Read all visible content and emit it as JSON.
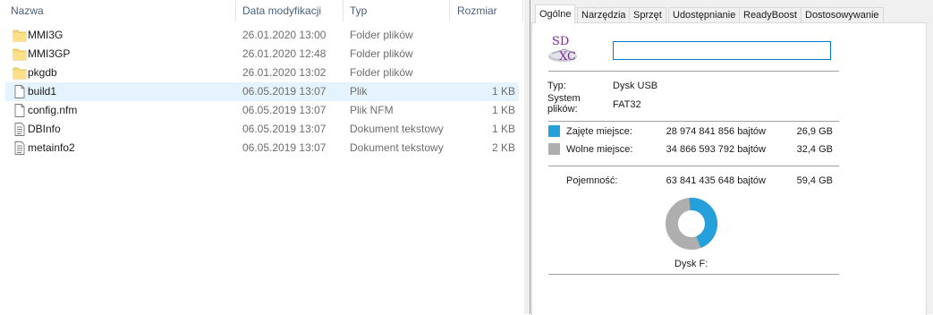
{
  "explorer": {
    "columns": {
      "name": "Nazwa",
      "date": "Data modyfikacji",
      "type": "Typ",
      "size": "Rozmiar"
    },
    "files": [
      {
        "name": "MMI3G",
        "date": "26.01.2020 13:00",
        "type": "Folder plików",
        "size": "",
        "icon": "folder-icon",
        "selected": false
      },
      {
        "name": "MMI3GP",
        "date": "26.01.2020 12:48",
        "type": "Folder plików",
        "size": "",
        "icon": "folder-icon",
        "selected": false
      },
      {
        "name": "pkgdb",
        "date": "26.01.2020 13:02",
        "type": "Folder plików",
        "size": "",
        "icon": "folder-icon",
        "selected": false
      },
      {
        "name": "build1",
        "date": "06.05.2019 13:07",
        "type": "Plik",
        "size": "1 KB",
        "icon": "file-icon",
        "selected": true
      },
      {
        "name": "config.nfm",
        "date": "06.05.2019 13:07",
        "type": "Plik NFM",
        "size": "1 KB",
        "icon": "file-icon",
        "selected": false
      },
      {
        "name": "DBInfo",
        "date": "06.05.2019 13:07",
        "type": "Dokument tekstowy",
        "size": "1 KB",
        "icon": "text-file-icon",
        "selected": false
      },
      {
        "name": "metainfo2",
        "date": "06.05.2019 13:07",
        "type": "Dokument tekstowy",
        "size": "2 KB",
        "icon": "text-file-icon",
        "selected": false
      }
    ]
  },
  "dialog": {
    "tabs": [
      "Ogólne",
      "Narzędzia",
      "Sprzęt",
      "Udostępnianie",
      "ReadyBoost",
      "Dostosowywanie"
    ],
    "active_tab": "Ogólne",
    "drive_icon_text": "SD\nXC",
    "name_value": "",
    "type_label": "Typ:",
    "type_value": "Dysk USB",
    "fs_label": "System plików:",
    "fs_value": "FAT32",
    "used": {
      "label": "Zajęte miejsce:",
      "bytes": "28 974 841 856 bajtów",
      "size": "26,9 GB",
      "color": "#26a0da"
    },
    "free": {
      "label": "Wolne miejsce:",
      "bytes": "34 866 593 792 bajtów",
      "size": "32,4 GB",
      "color": "#aeaeae"
    },
    "capacity": {
      "label": "Pojemność:",
      "bytes": "63 841 435 648 bajtów",
      "size": "59,4 GB"
    },
    "used_fraction": 0.454,
    "drive_label": "Dysk F:"
  }
}
